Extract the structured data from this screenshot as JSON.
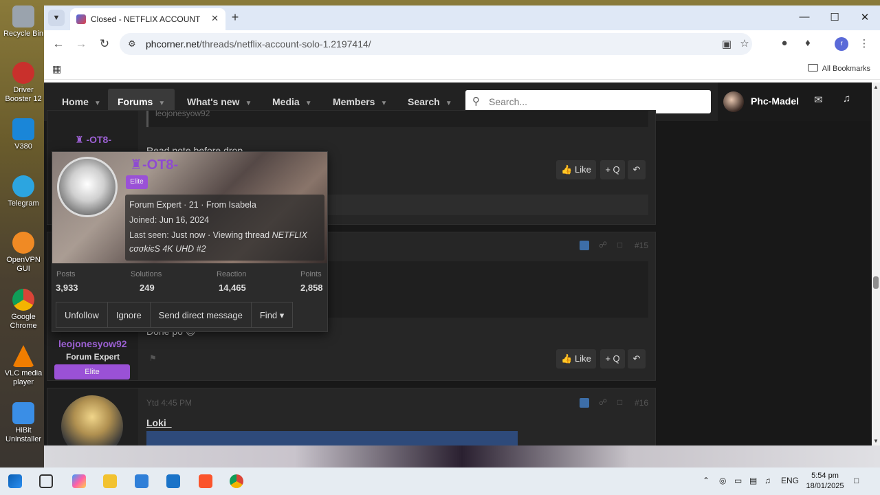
{
  "desktop": {
    "icons": [
      {
        "label": "Recycle Bin",
        "color": "#9aa3ad"
      },
      {
        "label": "Driver Booster 12",
        "color": "#c9302c"
      },
      {
        "label": "V380",
        "color": "#1a86d8"
      },
      {
        "label": "Telegram",
        "color": "#2ca5e0"
      },
      {
        "label": "OpenVPN GUI",
        "color": "#f08a24"
      },
      {
        "label": "Google Chrome",
        "color": "#2f9b4b"
      },
      {
        "label": "VLC media player",
        "color": "#f07d00"
      },
      {
        "label": "HiBit Uninstaller",
        "color": "#3a8ee6"
      }
    ]
  },
  "browser": {
    "tab_title": "Closed - NETFLIX ACCOUNT SO",
    "url_host": "phcorner.net",
    "url_path": "/threads/netflix-account-solo-1.2197414/",
    "profile_initial": "r",
    "all_bookmarks": "All Bookmarks"
  },
  "site": {
    "nav": [
      "Home",
      "Forums",
      "What's new",
      "Media",
      "Members",
      "Search"
    ],
    "search_placeholder": "Search...",
    "username": "Phc-Madel"
  },
  "posts": {
    "p1": {
      "username": "-OT8-",
      "quote_text": "leojonesyow92",
      "message": "Read note before drop",
      "like": "Like",
      "quote": "+ Q"
    },
    "p2": {
      "number": "#15",
      "username": "leojonesyow92",
      "title": "Forum Expert",
      "badge": "Elite",
      "message": "Done po 😊",
      "like": "Like",
      "quote": "+ Q"
    },
    "p3": {
      "time": "Ytd 4:45 PM",
      "number": "#16",
      "username": "Loki_"
    }
  },
  "card": {
    "name": "-OT8-",
    "badge": "Elite",
    "line1": "Forum Expert · 21 · From Isabela",
    "joined_label": "Joined:",
    "joined_value": "Jun 16, 2024",
    "seen_label": "Last seen:",
    "seen_value": "Just now · Viewing thread",
    "seen_thread": "NETFLIX",
    "seen_thread2": "cσσkiєS 4K UHD #2",
    "stats": [
      {
        "label": "Posts",
        "value": "3,933"
      },
      {
        "label": "Solutions",
        "value": "249"
      },
      {
        "label": "Reaction",
        "value": "14,465"
      },
      {
        "label": "Points",
        "value": "2,858"
      }
    ],
    "buttons": [
      "Unfollow",
      "Ignore",
      "Send direct message",
      "Find ▾"
    ]
  },
  "taskbar": {
    "lang": "ENG",
    "time": "5:54 pm",
    "date": "18/01/2025"
  }
}
